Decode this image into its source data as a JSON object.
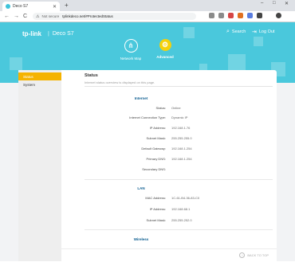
{
  "browser": {
    "tab_title": "Deco S7",
    "new_tab": "+",
    "window_controls": [
      "–",
      "□",
      "✕"
    ],
    "nav": {
      "back": "←",
      "forward": "→",
      "reload": "C"
    },
    "security_text": "Not secure",
    "url": "tplinkdeco.net/#ProtectedStatus",
    "extension_colors": [
      "#8a8a8a",
      "#8a8a8a",
      "#d64545",
      "#e07020",
      "#5a7de0",
      "#444444",
      "#444444"
    ]
  },
  "header": {
    "logo": "tp-link",
    "product": "Deco S7",
    "links": {
      "search": "Search",
      "logout": "Log Out"
    },
    "modes": {
      "network_map": "Network Map",
      "advanced": "Advanced"
    },
    "accent_color": "#4ac8dc",
    "active_color": "#f5d10b"
  },
  "sidebar": {
    "items": [
      {
        "label": "Status",
        "active": true
      },
      {
        "label": "System",
        "active": false
      }
    ]
  },
  "status": {
    "title": "Status",
    "subtitle": "Internet status overview is displayed on this page.",
    "internet": {
      "heading": "Internet",
      "rows": [
        {
          "label": "Status:",
          "value": "Online"
        },
        {
          "label": "Internet Connection Type:",
          "value": "Dynamic IP"
        },
        {
          "label": "IP Address:",
          "value": "192.168.1.76"
        },
        {
          "label": "Subnet Mask:",
          "value": "255.255.255.0"
        },
        {
          "label": "Default Gateway:",
          "value": "192.168.1.254"
        },
        {
          "label": "Primary DNS:",
          "value": "192.168.1.254"
        },
        {
          "label": "Secondary DNS:",
          "value": ""
        }
      ]
    },
    "lan": {
      "heading": "LAN",
      "rows": [
        {
          "label": "MAC Address:",
          "value": "1C-61-B4-36-83-C0"
        },
        {
          "label": "IP Address:",
          "value": "192.168.68.1"
        },
        {
          "label": "Subnet Mask:",
          "value": "255.255.252.0"
        }
      ]
    },
    "wireless": {
      "heading": "Wireless"
    }
  },
  "footer": {
    "back_to_top": "BACK TO TOP"
  }
}
